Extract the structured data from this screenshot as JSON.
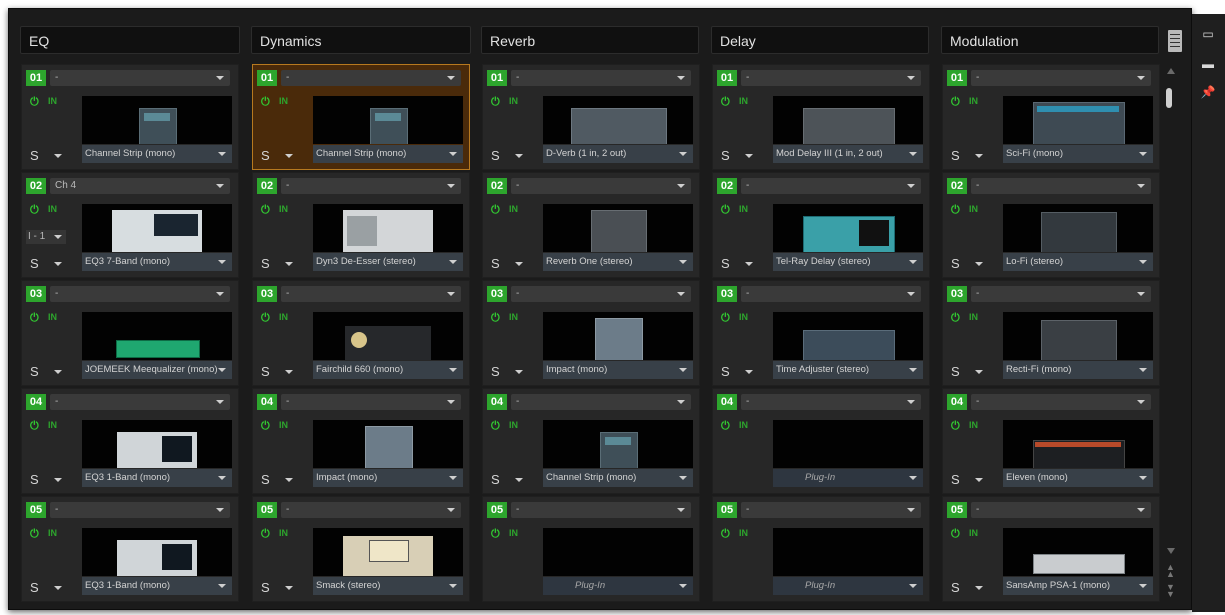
{
  "headers": [
    "EQ",
    "Dynamics",
    "Reverb",
    "Delay",
    "Modulation"
  ],
  "columns": [
    {
      "name": "EQ",
      "slots": [
        {
          "num": "01",
          "route": "-",
          "plugin": "Channel Strip (mono)",
          "preview": "strip"
        },
        {
          "num": "02",
          "route": "Ch 4",
          "io": "I - 1",
          "plugin": "EQ3 7-Band (mono)",
          "preview": "eq7"
        },
        {
          "num": "03",
          "route": "-",
          "plugin": "JOEMEEK Meequalizer (mono)",
          "preview": "joemeek"
        },
        {
          "num": "04",
          "route": "-",
          "plugin": "EQ3 1-Band (mono)",
          "preview": "eq1"
        },
        {
          "num": "05",
          "route": "-",
          "plugin": "EQ3 1-Band (mono)",
          "preview": "eq1"
        }
      ]
    },
    {
      "name": "Dynamics",
      "slots": [
        {
          "num": "01",
          "route": "-",
          "plugin": "Channel Strip (mono)",
          "preview": "strip",
          "selected": true
        },
        {
          "num": "02",
          "route": "-",
          "plugin": "Dyn3 De-Esser (stereo)",
          "preview": "deesser"
        },
        {
          "num": "03",
          "route": "-",
          "plugin": "Fairchild 660 (mono)",
          "preview": "fairchild"
        },
        {
          "num": "04",
          "route": "-",
          "plugin": "Impact (mono)",
          "preview": "impact"
        },
        {
          "num": "05",
          "route": "-",
          "plugin": "Smack (stereo)",
          "preview": "smack"
        }
      ]
    },
    {
      "name": "Reverb",
      "slots": [
        {
          "num": "01",
          "route": "-",
          "plugin": "D-Verb (1 in, 2 out)",
          "preview": "dverb"
        },
        {
          "num": "02",
          "route": "-",
          "plugin": "Reverb One (stereo)",
          "preview": "reverbone"
        },
        {
          "num": "03",
          "route": "-",
          "plugin": "Impact (mono)",
          "preview": "impact"
        },
        {
          "num": "04",
          "route": "-",
          "plugin": "Channel Strip (mono)",
          "preview": "strip"
        },
        {
          "num": "05",
          "route": "-",
          "plugin": "Plug-In",
          "empty": true
        }
      ]
    },
    {
      "name": "Delay",
      "slots": [
        {
          "num": "01",
          "route": "-",
          "plugin": "Mod Delay III (1 in, 2 out)",
          "preview": "moddelay"
        },
        {
          "num": "02",
          "route": "-",
          "plugin": "Tel-Ray Delay (stereo)",
          "preview": "telray"
        },
        {
          "num": "03",
          "route": "-",
          "plugin": "Time Adjuster (stereo)",
          "preview": "timeadj"
        },
        {
          "num": "04",
          "route": "-",
          "plugin": "Plug-In",
          "empty": true
        },
        {
          "num": "05",
          "route": "-",
          "plugin": "Plug-In",
          "empty": true
        }
      ]
    },
    {
      "name": "Modulation",
      "slots": [
        {
          "num": "01",
          "route": "-",
          "plugin": "Sci-Fi (mono)",
          "preview": "scifi"
        },
        {
          "num": "02",
          "route": "-",
          "plugin": "Lo-Fi (stereo)",
          "preview": "lofi"
        },
        {
          "num": "03",
          "route": "-",
          "plugin": "Recti-Fi (mono)",
          "preview": "rectifi"
        },
        {
          "num": "04",
          "route": "-",
          "plugin": "Eleven (mono)",
          "preview": "eleven"
        },
        {
          "num": "05",
          "route": "-",
          "plugin": "SansAmp PSA-1 (mono)",
          "preview": "sansamp"
        }
      ]
    }
  ],
  "labels": {
    "solo": "S",
    "input": "IN",
    "power": "⏻"
  },
  "colors": {
    "accent_green": "#2da52d",
    "selection_orange": "#b7791f",
    "plugin_field": "#384048",
    "pin": "#f2c21b"
  },
  "icons": [
    "list-icon",
    "compact-view-icon",
    "folder-icon",
    "pin-icon",
    "scroll-up-icon",
    "scroll-down-icon",
    "scroll-top-icon",
    "scroll-bottom-icon"
  ]
}
